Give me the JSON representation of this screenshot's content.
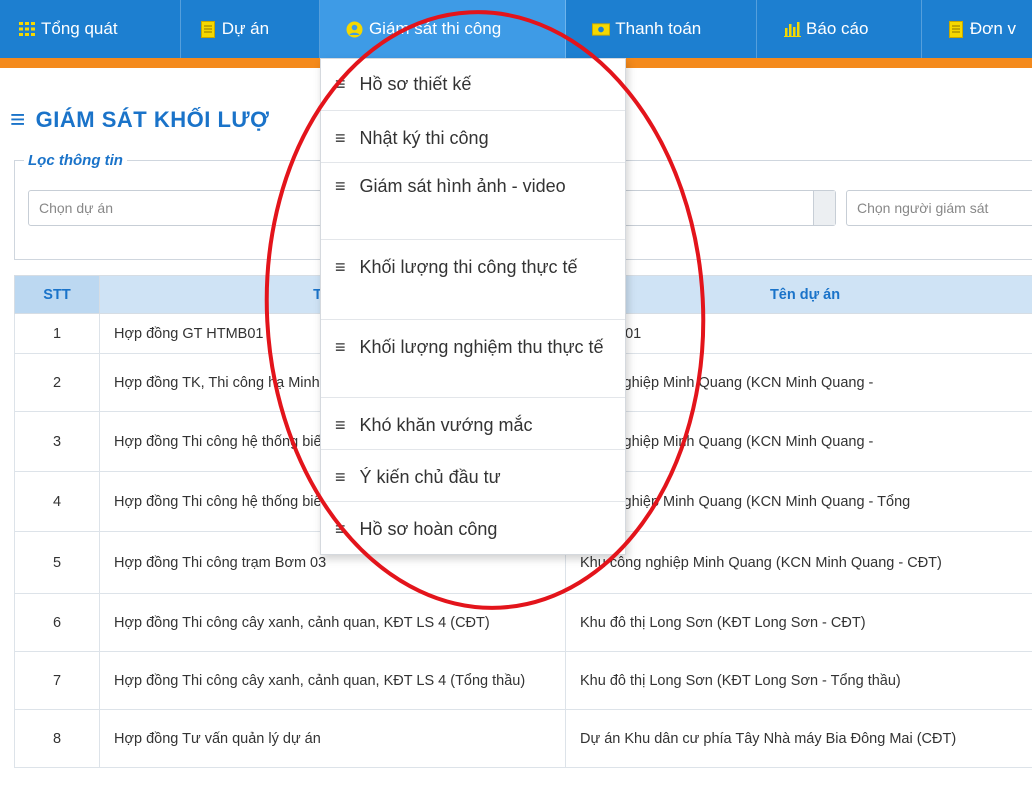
{
  "nav": [
    {
      "label": "Tổng quát",
      "icon": "grid-icon"
    },
    {
      "label": "Dự án",
      "icon": "document-icon"
    },
    {
      "label": "Giám sát thi công",
      "icon": "user-circle-icon"
    },
    {
      "label": "Thanh toán",
      "icon": "money-icon"
    },
    {
      "label": "Báo cáo",
      "icon": "bar-chart-icon"
    },
    {
      "label": "Đơn v",
      "icon": "document-icon"
    }
  ],
  "page": {
    "title": "GIÁM SÁT KHỐI LƯỢ"
  },
  "filter": {
    "legend": "Lọc thông tin",
    "project_placeholder": "Chọn dự án",
    "supervisor_placeholder": "Chọn người giám sát"
  },
  "table": {
    "headers": [
      "STT",
      "Tên h",
      "Tên dự án"
    ],
    "rows": [
      {
        "stt": "1",
        "name": "Hợp đồng GT HTMB01",
        "project": "HTMB 01"
      },
      {
        "stt": "2",
        "name": "Hợp đồng TK, Thi công hạ Minh Quang (CĐT)",
        "project": "công nghiệp Minh Quang (KCN Minh Quang -"
      },
      {
        "stt": "3",
        "name": "Hợp đồng Thi công hệ thống biến áp 50KVA cấp điện ch",
        "project": "công nghiệp Minh Quang (KCN Minh Quang -"
      },
      {
        "stt": "4",
        "name": "Hợp đồng Thi công hệ thống biến áp 50KVA cấp điện ch",
        "project": "công nghiệp Minh Quang (KCN Minh Quang - Tổng"
      },
      {
        "stt": "5",
        "name": "Hợp đồng Thi công trạm Bơm 03",
        "project": "Khu công nghiệp Minh Quang (KCN Minh Quang - CĐT)"
      },
      {
        "stt": "6",
        "name": "Hợp đồng Thi công cây xanh, cảnh quan, KĐT LS 4 (CĐT)",
        "project": "Khu đô thị Long Sơn (KĐT Long Sơn - CĐT)"
      },
      {
        "stt": "7",
        "name": "Hợp đồng Thi công cây xanh, cảnh quan, KĐT LS 4 (Tổng thầu)",
        "project": "Khu đô thị Long Sơn (KĐT Long Sơn - Tổng thầu)"
      },
      {
        "stt": "8",
        "name": "Hợp đồng Tư vấn quản lý dự án",
        "project": "Dự án Khu dân cư phía Tây Nhà máy Bia Đông Mai (CĐT)"
      }
    ]
  },
  "dropdown": {
    "items": [
      "Hồ sơ thiết kế",
      "Nhật ký thi công",
      "Giám sát hình ảnh - video",
      "Khối lượng thi công thực tế",
      "Khối lượng nghiệm thu thực tế",
      "Khó khăn vướng mắc",
      "Ý kiến chủ đầu tư",
      "Hồ sơ hoàn công"
    ]
  },
  "colors": {
    "nav_bg": "#1d7fd0",
    "nav_active": "#3e9be6",
    "accent_orange": "#f48a1c",
    "title_blue": "#1a73c9",
    "annotation_red": "#e3141b"
  }
}
